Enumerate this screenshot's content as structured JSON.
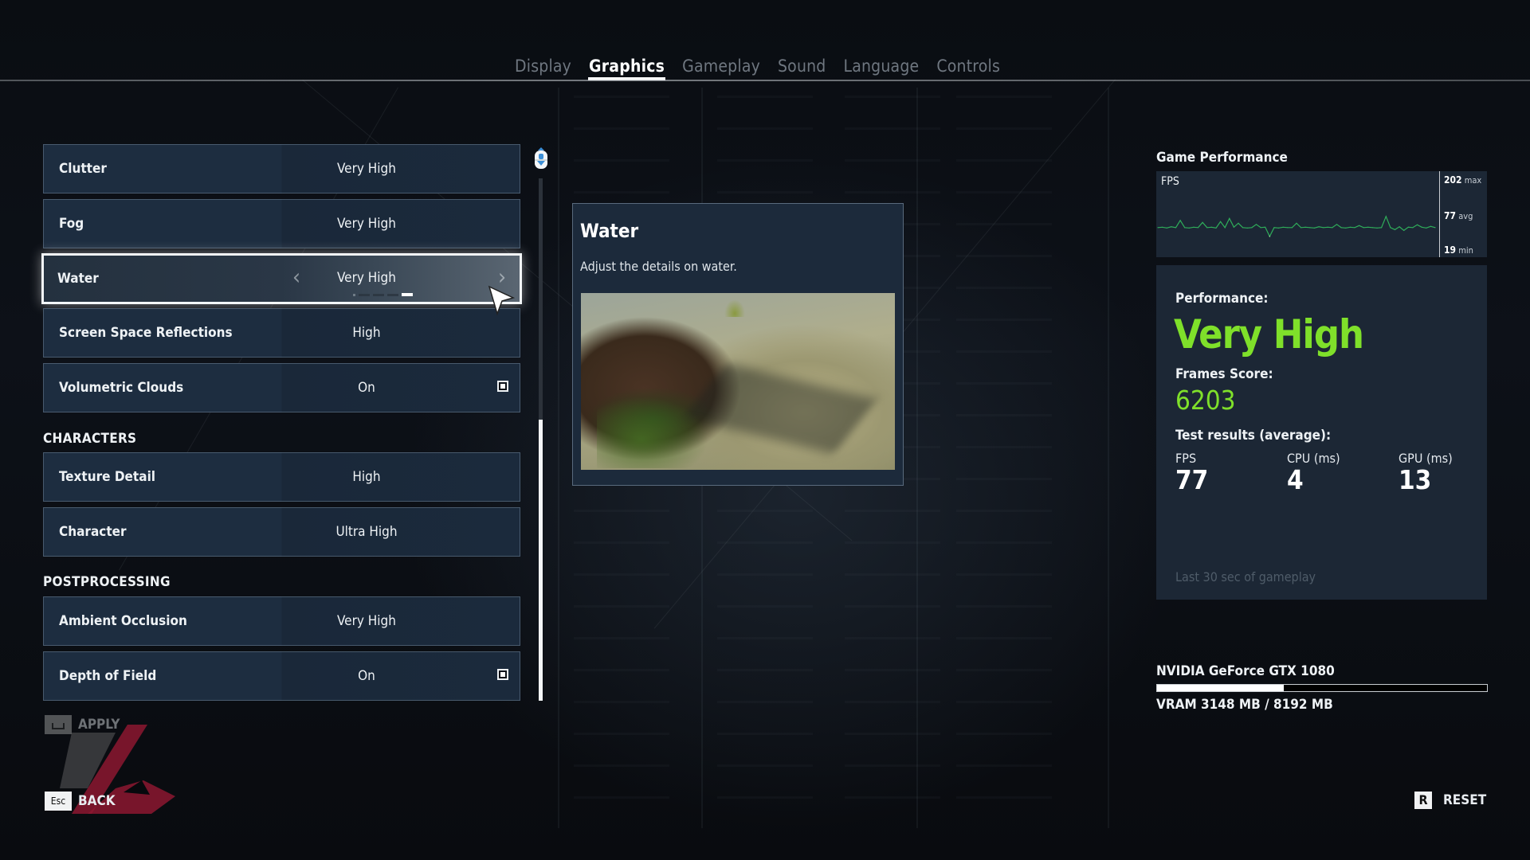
{
  "tabs": [
    {
      "label": "Display",
      "active": false
    },
    {
      "label": "Graphics",
      "active": true
    },
    {
      "label": "Gameplay",
      "active": false
    },
    {
      "label": "Sound",
      "active": false
    },
    {
      "label": "Language",
      "active": false
    },
    {
      "label": "Controls",
      "active": false
    }
  ],
  "settings": {
    "rows": [
      {
        "label": "Clutter",
        "value": "Very High"
      },
      {
        "label": "Fog",
        "value": "Very High"
      },
      {
        "label": "Water",
        "value": "Very High",
        "selected": true,
        "level_steps": 5,
        "level_active": 5
      },
      {
        "label": "Screen Space Reflections",
        "value": "High"
      },
      {
        "label": "Volumetric Clouds",
        "value": "On",
        "checkbox": true,
        "checked": true
      }
    ],
    "section_characters": "CHARACTERS",
    "characters_rows": [
      {
        "label": "Texture Detail",
        "value": "High"
      },
      {
        "label": "Character",
        "value": "Ultra High"
      }
    ],
    "section_postprocessing": "POSTPROCESSING",
    "postprocessing_rows": [
      {
        "label": "Ambient Occlusion",
        "value": "Very High"
      },
      {
        "label": "Depth of Field",
        "value": "On",
        "checkbox": true,
        "checked": true
      }
    ],
    "arrow_left": "‹",
    "arrow_right": "›"
  },
  "scroll": {
    "icon": "mouse-scroll-icon",
    "position_fraction": 1.0
  },
  "description": {
    "title": "Water",
    "text": "Adjust the details on water.",
    "image": "water-preview-image"
  },
  "performance": {
    "title": "Game Performance",
    "fps_chart_label": "FPS",
    "fps_max": "202",
    "fps_max_label": "max",
    "fps_avg": "77",
    "fps_avg_label": "avg",
    "fps_min": "19",
    "fps_min_label": "min",
    "performance_label": "Performance:",
    "performance_value": "Very High",
    "frames_score_label": "Frames Score:",
    "frames_score": "6203",
    "test_results_label": "Test results (average):",
    "results": [
      {
        "label": "FPS",
        "value": "77"
      },
      {
        "label": "CPU (ms)",
        "value": "4"
      },
      {
        "label": "GPU (ms)",
        "value": "13"
      }
    ],
    "footnote": "Last 30 sec of gameplay",
    "accent_color": "#7fe02a"
  },
  "gpu": {
    "name": "NVIDIA GeForce GTX 1080",
    "vram_used_mb": 3148,
    "vram_total_mb": 8192,
    "vram_text": "VRAM 3148 MB / 8192 MB"
  },
  "buttons": {
    "apply_label": "APPLY",
    "apply_key": "space-key-icon",
    "back_label": "BACK",
    "back_key": "Esc",
    "reset_label": "RESET",
    "reset_key": "R"
  },
  "chart_data": {
    "type": "line",
    "title": "FPS",
    "x": "last 30 sec of gameplay",
    "ylim": [
      19,
      202
    ],
    "annotations": [
      "202 max",
      "77 avg",
      "19 min"
    ],
    "series": [
      {
        "name": "FPS",
        "values": [
          77,
          78,
          76,
          79,
          77,
          95,
          77,
          76,
          78,
          77,
          90,
          77,
          78,
          76,
          92,
          77,
          100,
          78,
          88,
          77,
          76,
          77,
          85,
          77,
          78,
          55,
          77,
          76,
          78,
          77,
          77,
          88,
          77,
          78,
          77,
          76,
          79,
          77,
          78,
          77,
          85,
          77,
          76,
          78,
          77,
          82,
          77,
          78,
          77,
          76,
          77,
          105,
          77,
          72,
          79,
          70,
          78,
          77,
          84,
          78,
          76,
          80,
          77
        ]
      }
    ]
  }
}
